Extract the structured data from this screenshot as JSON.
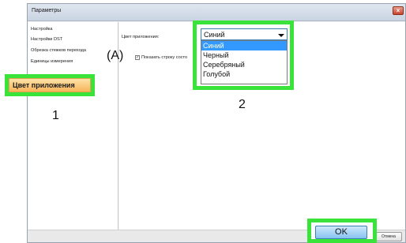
{
  "window": {
    "title": "Параметры",
    "close_glyph": "×"
  },
  "sidebar": {
    "items": [
      {
        "label": "Настройка"
      },
      {
        "label": "Настройки DST"
      },
      {
        "label": "Обрезка стежков перехода"
      },
      {
        "label": "Единицы измерения"
      }
    ],
    "highlighted_item": {
      "label": "Цвет приложения"
    }
  },
  "content": {
    "app_color_label": "Цвет приложения:",
    "status_checkbox_label": "Показать строку состо",
    "checkbox_mark": "✓"
  },
  "dropdown": {
    "value": "Синий",
    "options": [
      {
        "label": "Синий",
        "selected": true
      },
      {
        "label": "Черный",
        "selected": false
      },
      {
        "label": "Серебряный",
        "selected": false
      },
      {
        "label": "Голубой",
        "selected": false
      }
    ]
  },
  "buttons": {
    "ok_label": "OK",
    "cancel_label": "Отмена"
  },
  "annotations": {
    "a": "(A)",
    "one": "1",
    "two": "2"
  },
  "colors": {
    "highlight_frame": "#39e33a",
    "selected_option": "#3399ff",
    "ok_button": "#86c2f0"
  },
  "icons": {
    "close": "close-icon",
    "dropdown_arrow": "chevron-down-icon"
  }
}
